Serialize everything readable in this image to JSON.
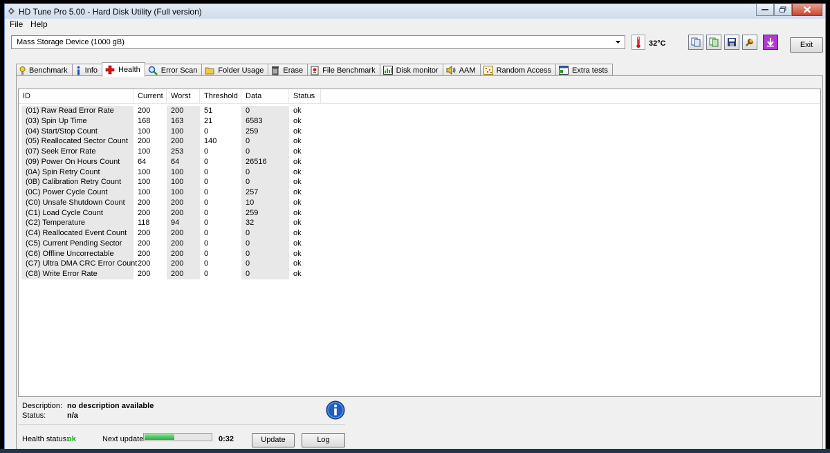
{
  "window": {
    "title": "HD Tune Pro 5.00 - Hard Disk Utility (Full version)"
  },
  "menu": {
    "file": "File",
    "help": "Help"
  },
  "device": {
    "selected": "Mass Storage Device  (1000 gB)"
  },
  "temperature": {
    "value": "32°C"
  },
  "toolbar": {
    "exit_label": "Exit"
  },
  "tabs": [
    {
      "label": "Benchmark",
      "icon": "benchmark-icon"
    },
    {
      "label": "Info",
      "icon": "info-icon"
    },
    {
      "label": "Health",
      "icon": "health-cross-icon",
      "active": true
    },
    {
      "label": "Error Scan",
      "icon": "magnifier-icon"
    },
    {
      "label": "Folder Usage",
      "icon": "folder-icon"
    },
    {
      "label": "Erase",
      "icon": "trash-icon"
    },
    {
      "label": "File Benchmark",
      "icon": "file-benchmark-icon"
    },
    {
      "label": "Disk monitor",
      "icon": "disk-monitor-icon"
    },
    {
      "label": "AAM",
      "icon": "speaker-icon"
    },
    {
      "label": "Random Access",
      "icon": "random-access-icon"
    },
    {
      "label": "Extra tests",
      "icon": "extra-tests-icon"
    }
  ],
  "table": {
    "columns": [
      "ID",
      "Current",
      "Worst",
      "Threshold",
      "Data",
      "Status"
    ],
    "rows": [
      [
        "(01) Raw Read Error Rate",
        "200",
        "200",
        "51",
        "0",
        "ok"
      ],
      [
        "(03) Spin Up Time",
        "168",
        "163",
        "21",
        "6583",
        "ok"
      ],
      [
        "(04) Start/Stop Count",
        "100",
        "100",
        "0",
        "259",
        "ok"
      ],
      [
        "(05) Reallocated Sector Count",
        "200",
        "200",
        "140",
        "0",
        "ok"
      ],
      [
        "(07) Seek Error Rate",
        "100",
        "253",
        "0",
        "0",
        "ok"
      ],
      [
        "(09) Power On Hours Count",
        "64",
        "64",
        "0",
        "26516",
        "ok"
      ],
      [
        "(0A) Spin Retry Count",
        "100",
        "100",
        "0",
        "0",
        "ok"
      ],
      [
        "(0B) Calibration Retry Count",
        "100",
        "100",
        "0",
        "0",
        "ok"
      ],
      [
        "(0C) Power Cycle Count",
        "100",
        "100",
        "0",
        "257",
        "ok"
      ],
      [
        "(C0) Unsafe Shutdown Count",
        "200",
        "200",
        "0",
        "10",
        "ok"
      ],
      [
        "(C1) Load Cycle Count",
        "200",
        "200",
        "0",
        "259",
        "ok"
      ],
      [
        "(C2) Temperature",
        "118",
        "94",
        "0",
        "32",
        "ok"
      ],
      [
        "(C4) Reallocated Event Count",
        "200",
        "200",
        "0",
        "0",
        "ok"
      ],
      [
        "(C5) Current Pending Sector",
        "200",
        "200",
        "0",
        "0",
        "ok"
      ],
      [
        "(C6) Offline Uncorrectable",
        "200",
        "200",
        "0",
        "0",
        "ok"
      ],
      [
        "(C7) Ultra DMA CRC Error Count",
        "200",
        "200",
        "0",
        "0",
        "ok"
      ],
      [
        "(C8) Write Error Rate",
        "200",
        "200",
        "0",
        "0",
        "ok"
      ]
    ]
  },
  "details": {
    "description_label": "Description:",
    "description_value": "no description available",
    "status_label": "Status:",
    "status_value": "n/a"
  },
  "footer": {
    "health_label": "Health status:",
    "health_value": "ok",
    "health_color": "#1fa31f",
    "next_update_label": "Next update:",
    "countdown": "0:32",
    "progress": 0.45,
    "update_label": "Update",
    "log_label": "Log"
  }
}
